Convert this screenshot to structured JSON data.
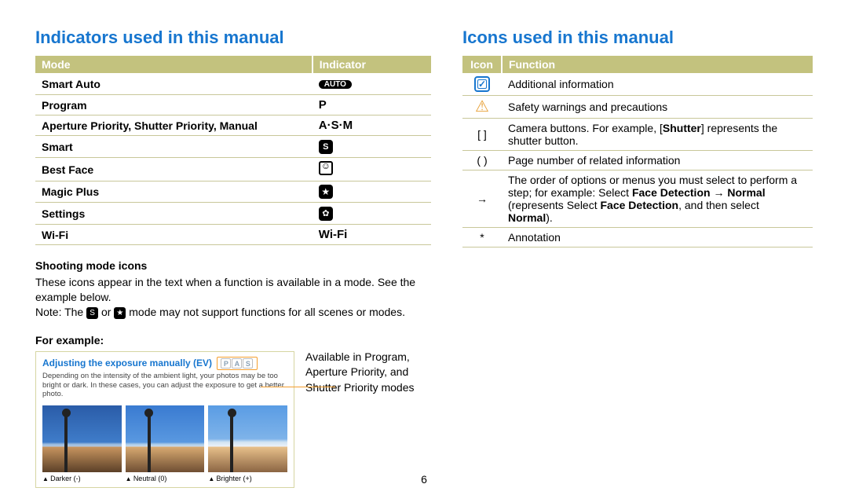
{
  "left": {
    "heading": "Indicators used in this manual",
    "table": {
      "headers": {
        "mode": "Mode",
        "indicator": "Indicator"
      },
      "rows": [
        {
          "mode": "Smart Auto",
          "indicator_type": "auto",
          "indicator": "AUTO"
        },
        {
          "mode": "Program",
          "indicator_type": "letter",
          "indicator": "P"
        },
        {
          "mode": "Aperture Priority, Shutter Priority, Manual",
          "indicator_type": "letters",
          "indicator": "A·S·M"
        },
        {
          "mode": "Smart",
          "indicator_type": "circle-s",
          "indicator": "S"
        },
        {
          "mode": "Best Face",
          "indicator_type": "face",
          "indicator": ""
        },
        {
          "mode": "Magic Plus",
          "indicator_type": "star",
          "indicator": "★"
        },
        {
          "mode": "Settings",
          "indicator_type": "gear",
          "indicator": "✿"
        },
        {
          "mode": "Wi-Fi",
          "indicator_type": "wifi",
          "indicator": "Wi-Fi"
        }
      ]
    },
    "section_icons_h": "Shooting mode icons",
    "section_icons_text": "These icons appear in the text when a function is available in a mode. See the example below.",
    "note_prefix": "Note: The ",
    "note_mid": " or ",
    "note_suffix": " mode may not support functions for all scenes or modes.",
    "example_h": "For example:",
    "example": {
      "title": "Adjusting the exposure manually (EV)",
      "pas": [
        "P",
        "A",
        "S"
      ],
      "desc": "Depending on the intensity of the ambient light, your photos may be too bright or dark. In these cases, you can adjust the exposure to get a better photo.",
      "captions": [
        "Darker (-)",
        "Neutral (0)",
        "Brighter (+)"
      ]
    },
    "side_text": "Available in Program, Aperture Priority, and Shutter Priority modes"
  },
  "right": {
    "heading": "Icons used in this manual",
    "table": {
      "headers": {
        "icon": "Icon",
        "function": "Function"
      },
      "rows": [
        {
          "icon": "info",
          "text": "Additional information"
        },
        {
          "icon": "warn",
          "text": "Safety warnings and precautions"
        },
        {
          "icon": "[  ]",
          "text_plain_pre": "Camera buttons. For example, [",
          "bold1": "Shutter",
          "text_plain_post": "] represents the shutter button."
        },
        {
          "icon": "(  )",
          "text": "Page number of related information"
        },
        {
          "icon": "→",
          "text_plain_pre": "The order of options or menus you must select to perform a step; for example: Select ",
          "bold1": "Face Detection",
          "arrow": " → ",
          "bold2": "Normal",
          "paren_pre": " (represents Select ",
          "bold3": "Face Detection",
          "mid": ", and then select ",
          "bold4": "Normal",
          "paren_close": ")."
        },
        {
          "icon": "*",
          "text": "Annotation"
        }
      ]
    }
  },
  "page_num": "6"
}
